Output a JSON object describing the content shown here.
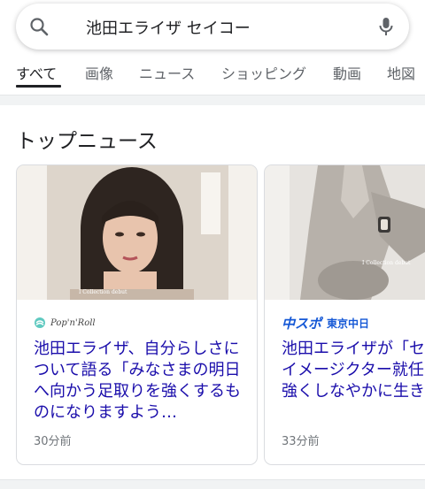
{
  "search": {
    "query": "池田エライザ セイコー"
  },
  "tabs": [
    {
      "label": "すべて",
      "active": true
    },
    {
      "label": "画像"
    },
    {
      "label": "ニュース"
    },
    {
      "label": "ショッピング"
    },
    {
      "label": "動画"
    },
    {
      "label": "地図"
    }
  ],
  "section": {
    "title": "トップニュース"
  },
  "cards": [
    {
      "source": "Pop'n'Roll",
      "headline": "池田エライザ、自分らしさについて語る「みなさまの明日へ向かう足取りを強くするものになりますよう…",
      "time": "30分前"
    },
    {
      "source": "中スポ 東京中日スポーツ",
      "source_main": "中スポ",
      "source_sub": "東京中日",
      "headline": "池田エライザが「セルキア」のイメージクター就任「今といを強くしなやかに生き",
      "time": "33分前"
    }
  ],
  "colors": {
    "link": "#1a0dab",
    "accent": "#1558d6",
    "tab_active": "#202124"
  }
}
